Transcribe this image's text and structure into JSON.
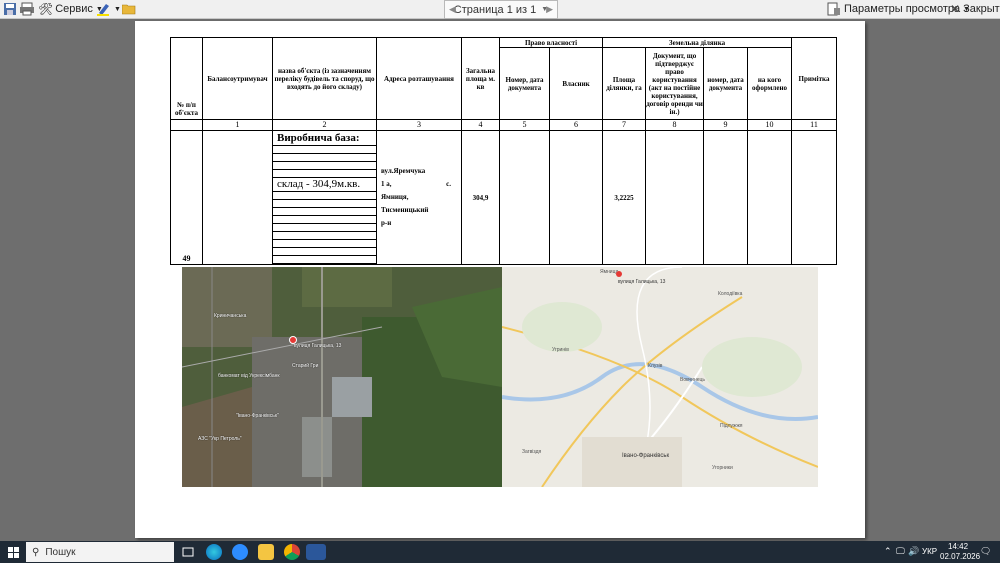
{
  "toolbar": {
    "service_label": "Сервис",
    "page_indicator": "Страница 1 из 1",
    "view_params_label": "Параметры просмотра",
    "close_label": "Закрыть"
  },
  "table": {
    "headers": {
      "num": "№ п/п об'єкта",
      "balance_holder": "Балансоутримувач",
      "object_name": "назва об'єкта (із зазначенням переліку будівель та споруд, що входять до його складу)",
      "address": "Адреса розташування",
      "total_area": "Загальна площа м. кв",
      "ownership_group": "Право власності",
      "ownership_doc": "Номер, дата документа",
      "owner": "Власник",
      "land_group": "Земельна ділянка",
      "land_area": "Площа ділянки, га",
      "land_doc": "Документ, що підтверджує право користування (акт на постійне користування, договір оренди чи ін.)",
      "land_doc_num": "номер, дата документа",
      "land_registered_to": "на кого оформлено",
      "note": "Примітка"
    },
    "col_numbers": [
      "1",
      "2",
      "3",
      "4",
      "5",
      "6",
      "7",
      "8",
      "9",
      "10",
      "11"
    ],
    "row": {
      "num": "49",
      "base_title": "Виробнича база:",
      "item": "склад - 304,9м.кв.",
      "address_line1": "вул.Яремчука",
      "address_line2": "1 а,",
      "address_line2b": "с.",
      "address_line3": "Ямниця,",
      "address_line4": "Тисменицький",
      "address_line5": "р-н",
      "area": "304,9",
      "land_area": "3,2225"
    }
  },
  "satellite": {
    "labels": [
      "Криничанська",
      "вулиця Галицька, 13",
      "банкомат від Укрексімбанк",
      "\"Івано-Франківськ\"",
      "АЗС \"Укр Петроль\"",
      "Старий Гри",
      "Ямниця"
    ]
  },
  "map": {
    "labels": [
      "Ямниця",
      "вулиця Галицька, 13",
      "Колодіївка",
      "Угринів",
      "Клузів",
      "Вовчинець",
      "Підлужжя",
      "Загвіздя",
      "Івано-Франківськ",
      "Угорники"
    ]
  },
  "taskbar": {
    "search_placeholder": "Пошук",
    "lang": "УКР",
    "time": "14:42",
    "date": "02.07.2026"
  }
}
